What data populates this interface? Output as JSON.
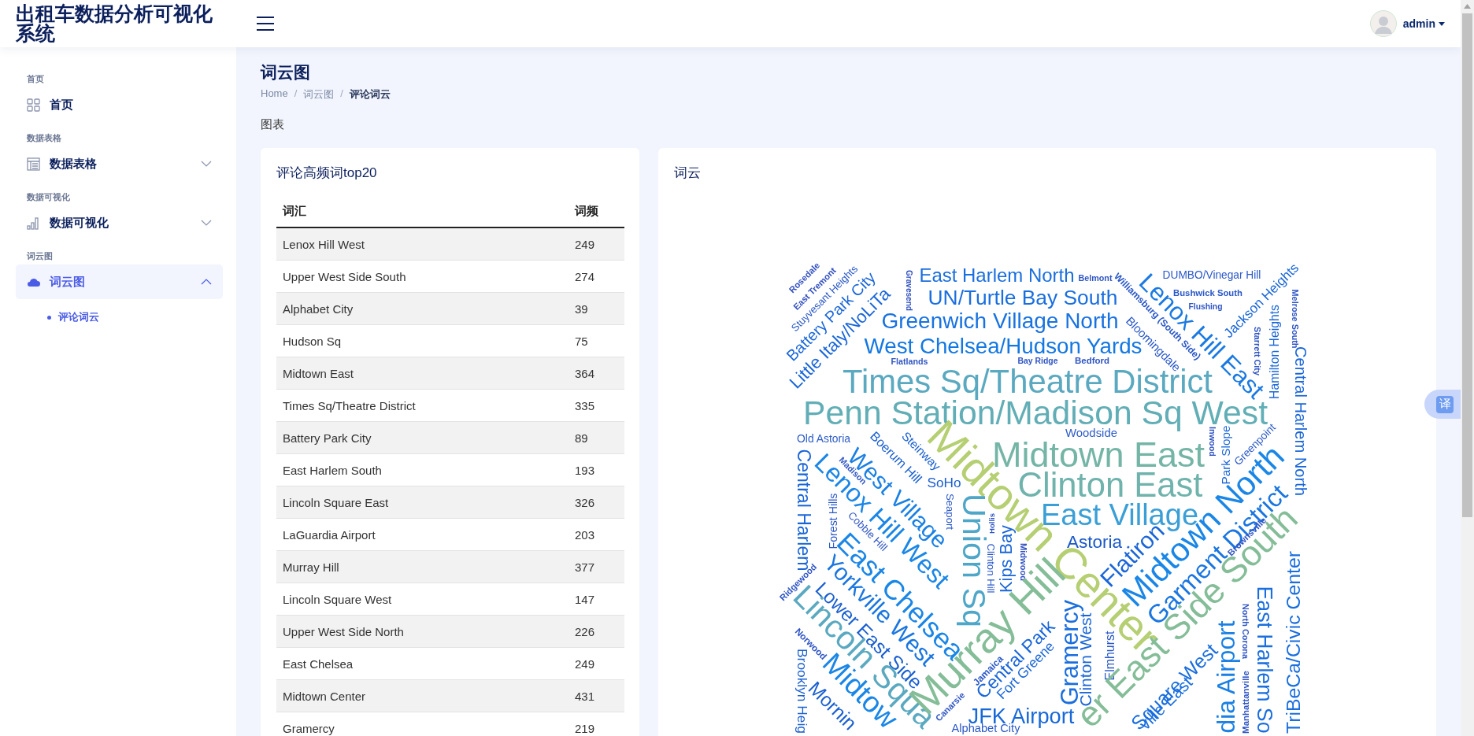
{
  "header": {
    "title": "出租车数据分析可视化系统",
    "user": "admin"
  },
  "sidebar": {
    "sections": [
      {
        "heading": "首页",
        "item": {
          "label": "首页",
          "selected": false
        }
      },
      {
        "heading": "数据表格",
        "item": {
          "label": "数据表格",
          "selected": false,
          "expanded": false
        }
      },
      {
        "heading": "数据可视化",
        "item": {
          "label": "数据可视化",
          "selected": false,
          "expanded": false
        }
      },
      {
        "heading": "词云图",
        "item": {
          "label": "词云图",
          "selected": true,
          "expanded": true,
          "children": [
            {
              "label": "评论词云",
              "selected": true
            }
          ]
        }
      }
    ]
  },
  "page": {
    "title": "词云图",
    "breadcrumb": [
      {
        "kind": "link",
        "text": "Home"
      },
      {
        "kind": "separator",
        "text": "/"
      },
      {
        "kind": "link",
        "text": "词云图"
      },
      {
        "kind": "separator",
        "text": "/"
      },
      {
        "kind": "current",
        "text": "评论词云"
      }
    ],
    "section_label": "图表"
  },
  "table_card": {
    "title": "评论高频词top20",
    "columns": [
      "词汇",
      "词频"
    ],
    "rows": [
      [
        "Lenox Hill West",
        "249"
      ],
      [
        "Upper West Side South",
        "274"
      ],
      [
        "Alphabet City",
        "39"
      ],
      [
        "Hudson Sq",
        "75"
      ],
      [
        "Midtown East",
        "364"
      ],
      [
        "Times Sq/Theatre District",
        "335"
      ],
      [
        "Battery Park City",
        "89"
      ],
      [
        "East Harlem South",
        "193"
      ],
      [
        "Lincoln Square East",
        "326"
      ],
      [
        "LaGuardia Airport",
        "203"
      ],
      [
        "Murray Hill",
        "377"
      ],
      [
        "Lincoln Square West",
        "147"
      ],
      [
        "Upper West Side North",
        "226"
      ],
      [
        "East Chelsea",
        "249"
      ],
      [
        "Midtown Center",
        "431"
      ],
      [
        "Gramercy",
        "219"
      ]
    ]
  },
  "cloud_card": {
    "title": "词云",
    "words": [
      {
        "text": "East Harlem North",
        "color": "#1a6ede"
      },
      {
        "text": "Belmont",
        "color": "#2f55c4"
      },
      {
        "text": "DUMBO/Vinegar Hill",
        "color": "#2a58c8"
      },
      {
        "text": "UN/Turtle Bay South",
        "color": "#1a6ede"
      },
      {
        "text": "Bushwick South",
        "color": "#2a58c8"
      },
      {
        "text": "Flushing",
        "color": "#2f55c4"
      },
      {
        "text": "Greenwich Village North",
        "color": "#1872e0"
      },
      {
        "text": "West Chelsea/Hudson Yards",
        "color": "#1478e2"
      },
      {
        "text": "Flatlands",
        "color": "#2f55c4"
      },
      {
        "text": "Bay Ridge",
        "color": "#2f55c4"
      },
      {
        "text": "Bedford",
        "color": "#2f55c4"
      },
      {
        "text": "Times Sq/Theatre District",
        "color": "#5aa9c0"
      },
      {
        "text": "Penn Station/Madison Sq West",
        "color": "#62aeb6"
      },
      {
        "text": "Woodside",
        "color": "#2d5cc8"
      },
      {
        "text": "Old Astoria",
        "color": "#2d5cc8"
      },
      {
        "text": "Midtown East",
        "color": "#74b5a6"
      },
      {
        "text": "SoHo",
        "color": "#1a5fd0"
      },
      {
        "text": "Clinton East",
        "color": "#6fb3ac"
      },
      {
        "text": "East Village",
        "color": "#3a9fd6"
      },
      {
        "text": "Astoria",
        "color": "#1a58c8"
      },
      {
        "text": "JFK Airport",
        "color": "#1768d8"
      },
      {
        "text": "Alphabet City",
        "color": "#2a58c8"
      },
      {
        "text": "Rosedale",
        "color": "#3552c0"
      },
      {
        "text": "East Tremont",
        "color": "#3552c0"
      },
      {
        "text": "Stuyvesant Heights",
        "color": "#2a58c8"
      },
      {
        "text": "Battery Park City",
        "color": "#1a66d8"
      },
      {
        "text": "Little Italy/NoLiTa",
        "color": "#1a66d8"
      },
      {
        "text": "Gravesend",
        "color": "#2f50c0"
      },
      {
        "text": "Williamsburg (South Side)",
        "color": "#2a58c8"
      },
      {
        "text": "Bloomingdale",
        "color": "#2a58c8"
      },
      {
        "text": "Lenox Hill East",
        "color": "#1a7ae2"
      },
      {
        "text": "Jackson Heights",
        "color": "#1a66d8"
      },
      {
        "text": "Starrett City",
        "color": "#2f55c4"
      },
      {
        "text": "Hamilton Heights",
        "color": "#1a66d8"
      },
      {
        "text": "Melrose South",
        "color": "#2f55c4"
      },
      {
        "text": "Central Harlem North",
        "color": "#1a66d8"
      },
      {
        "text": "Inwood",
        "color": "#2f50c0"
      },
      {
        "text": "Park Slope",
        "color": "#1a66d8"
      },
      {
        "text": "Greenpoint",
        "color": "#2a58c8"
      },
      {
        "text": "Midtown Center",
        "color": "#b5cf72"
      },
      {
        "text": "Central Harlem",
        "color": "#1a66d8"
      },
      {
        "text": "Madison",
        "color": "#2f55c4"
      },
      {
        "text": "Boerum Hill",
        "color": "#1a5fd0"
      },
      {
        "text": "Steinway",
        "color": "#1a5fd0"
      },
      {
        "text": "West Village",
        "color": "#1a80e4"
      },
      {
        "text": "Lenox Hill West",
        "color": "#1a86e6"
      },
      {
        "text": "Union Sq",
        "color": "#4ea6c8"
      },
      {
        "text": "Seaport",
        "color": "#2a58c8"
      },
      {
        "text": "Hollis",
        "color": "#2f55c4"
      },
      {
        "text": "Clinton Hill",
        "color": "#2a58c8"
      },
      {
        "text": "Kips Bay",
        "color": "#1a66d8"
      },
      {
        "text": "Midwood",
        "color": "#2f50c0"
      },
      {
        "text": "Forest Hills",
        "color": "#2a58c8"
      },
      {
        "text": "Cobble Hill",
        "color": "#2f55c4"
      },
      {
        "text": "Ridgewood",
        "color": "#2f55c4"
      },
      {
        "text": "East Chelsea",
        "color": "#1a86e6"
      },
      {
        "text": "Yorkville West",
        "color": "#1a76e0"
      },
      {
        "text": "Lower East Side",
        "color": "#1a5fd0"
      },
      {
        "text": "Norwood",
        "color": "#2f55c4"
      },
      {
        "text": "Lincoln Squa",
        "color": "#5aa9c0"
      },
      {
        "text": "Murray Hill",
        "color": "#84bd98"
      },
      {
        "text": "Brooklyn Heig",
        "color": "#1a5fd0"
      },
      {
        "text": "Midtow",
        "color": "#1a86e6"
      },
      {
        "text": "Mornin",
        "color": "#1a5fd0"
      },
      {
        "text": "Jamaica",
        "color": "#2a58c8"
      },
      {
        "text": "Canarsie",
        "color": "#2f55c4"
      },
      {
        "text": "Central Park",
        "color": "#1a66d8"
      },
      {
        "text": "Fort Greene",
        "color": "#1a66d8"
      },
      {
        "text": "Gramercy",
        "color": "#1a6ede"
      },
      {
        "text": "Clinton West",
        "color": "#1a66d8"
      },
      {
        "text": "Elmhurst",
        "color": "#2a58c8"
      },
      {
        "text": "Flatiron",
        "color": "#1a66d8"
      },
      {
        "text": "Midtown North",
        "color": "#1a86e6"
      },
      {
        "text": "Garment District",
        "color": "#1a76e0"
      },
      {
        "text": "Brownsville",
        "color": "#2f55c4"
      },
      {
        "text": "er East Side South",
        "color": "#84bd98"
      },
      {
        "text": "Square West",
        "color": "#1a6ede"
      },
      {
        "text": "ville East",
        "color": "#1a6ede"
      },
      {
        "text": "dia Airport",
        "color": "#1a80e4"
      },
      {
        "text": "North Corona",
        "color": "#2f55c4"
      },
      {
        "text": "Manhattanville",
        "color": "#2f55c4"
      },
      {
        "text": "East Harlem So",
        "color": "#1a6ede"
      },
      {
        "text": "TriBeCa/Civic Center",
        "color": "#1a6ede"
      }
    ]
  },
  "translate_button": "译"
}
